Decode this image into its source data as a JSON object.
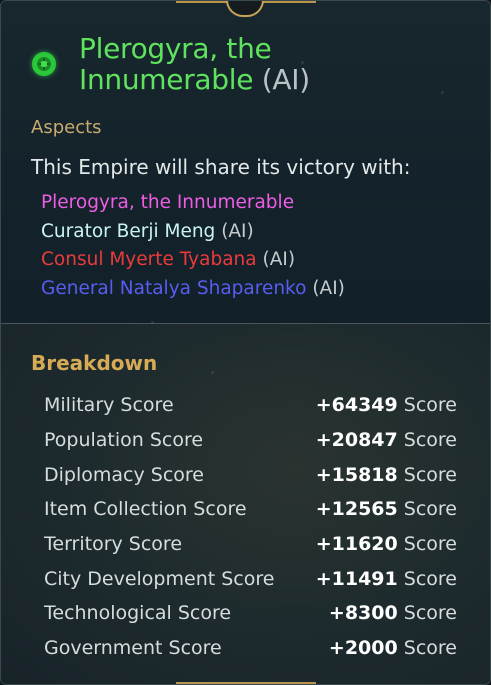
{
  "empire": {
    "name": "Plerogyra, the Innumerable",
    "ai_tag": "(AI)",
    "color": "#5fe35f"
  },
  "aspects": {
    "label": "Aspects",
    "share_text": "This Empire will share its victory with:"
  },
  "partners": [
    {
      "name": "Plerogyra, the Innumerable",
      "ai_tag": "",
      "color": "#ef5ce6"
    },
    {
      "name": "Curator Berji Meng",
      "ai_tag": "(AI)",
      "color": "#c9f4f4"
    },
    {
      "name": "Consul Myerte Tyabana",
      "ai_tag": "(AI)",
      "color": "#ea3b3b"
    },
    {
      "name": "General Natalya Shaparenko",
      "ai_tag": "(AI)",
      "color": "#5a5cf0"
    }
  ],
  "breakdown": {
    "title": "Breakdown",
    "unit": "Score",
    "rows": [
      {
        "label": "Military Score",
        "value": "+64349"
      },
      {
        "label": "Population Score",
        "value": "+20847"
      },
      {
        "label": "Diplomacy Score",
        "value": "+15818"
      },
      {
        "label": "Item Collection Score",
        "value": "+12565"
      },
      {
        "label": "Territory Score",
        "value": "+11620"
      },
      {
        "label": "City Development Score",
        "value": "+11491"
      },
      {
        "label": "Technological Score",
        "value": "+8300"
      },
      {
        "label": "Government Score",
        "value": "+2000"
      }
    ]
  },
  "icons": {
    "empire": "empire-emblem-icon",
    "lock": "lock-icon"
  }
}
